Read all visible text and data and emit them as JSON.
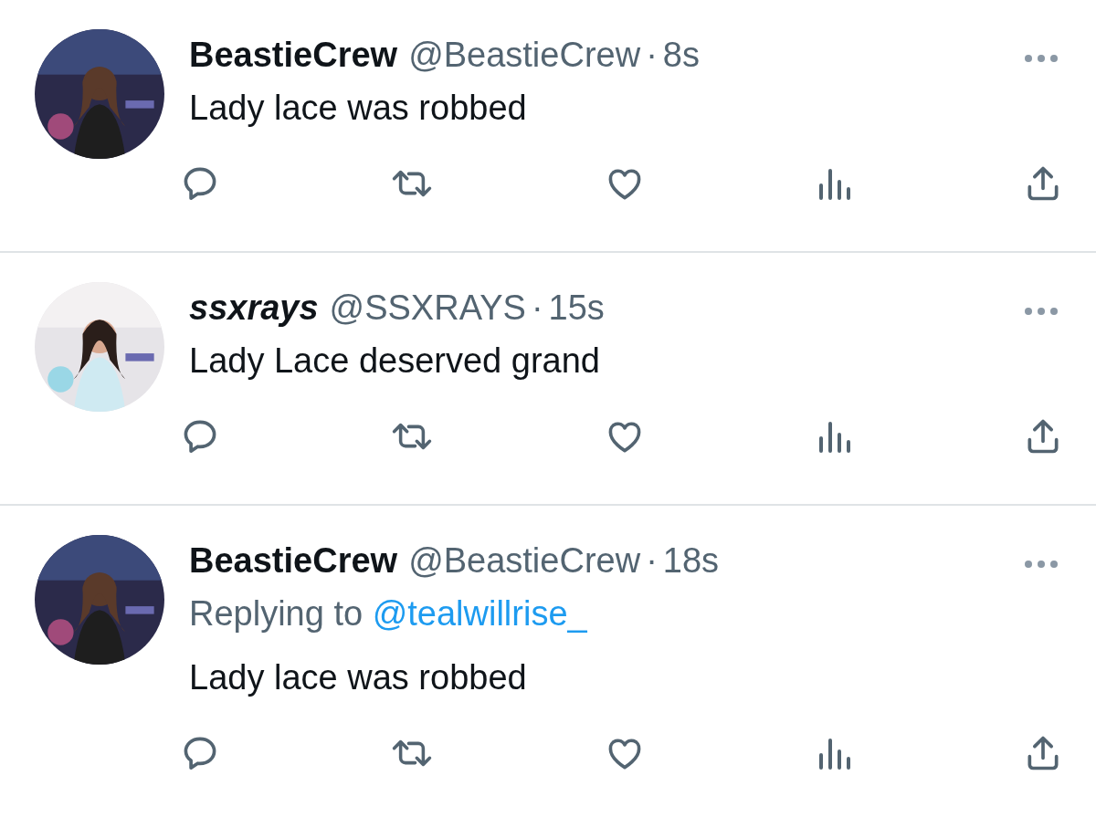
{
  "tweets": [
    {
      "name": "BeastieCrew",
      "italic": false,
      "handle": "@BeastieCrew",
      "separator": "·",
      "time": "8s",
      "text": "Lady lace was robbed"
    },
    {
      "name": "ssxrays",
      "italic": true,
      "handle": "@SSXRAYS",
      "separator": "·",
      "time": "15s",
      "text": "Lady Lace deserved grand"
    },
    {
      "name": "BeastieCrew",
      "italic": false,
      "handle": "@BeastieCrew",
      "separator": "·",
      "time": "18s",
      "replying_label": "Replying to",
      "replying_to": "@tealwillrise_",
      "text": "Lady lace was robbed"
    }
  ]
}
